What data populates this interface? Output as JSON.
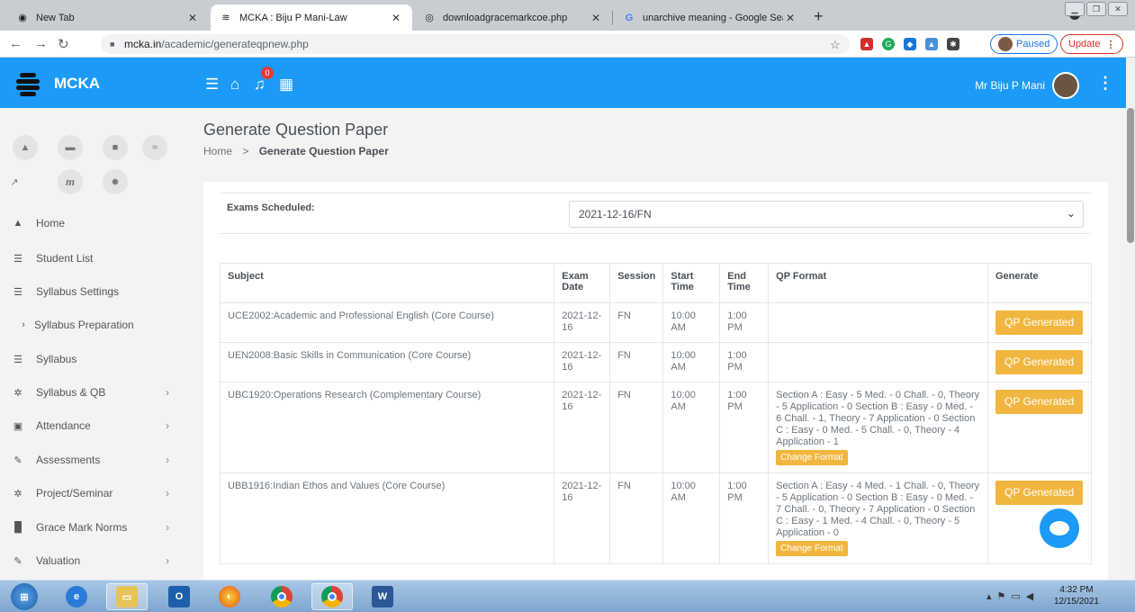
{
  "browser": {
    "tabs": [
      {
        "title": "New Tab"
      },
      {
        "title": "MCKA : Biju P Mani-Law"
      },
      {
        "title": "downloadgracemarkcoe.php"
      },
      {
        "title": "unarchive meaning - Google Sea"
      }
    ],
    "url_host": "mcka.in",
    "url_path": "/academic/generateqpnew.php",
    "paused_label": "Paused",
    "update_label": "Update"
  },
  "header": {
    "brand": "MCKA",
    "notif_count": "0",
    "user_name": "Mr Biju P Mani"
  },
  "sidebar": {
    "items": [
      {
        "label": "Home"
      },
      {
        "label": "Student List"
      },
      {
        "label": "Syllabus Settings"
      },
      {
        "label": "Syllabus Preparation"
      },
      {
        "label": "Syllabus"
      },
      {
        "label": "Syllabus & QB"
      },
      {
        "label": "Attendance"
      },
      {
        "label": "Assessments"
      },
      {
        "label": "Project/Seminar"
      },
      {
        "label": "Grace Mark Norms"
      },
      {
        "label": "Valuation"
      }
    ],
    "quick_m": "m"
  },
  "main": {
    "title": "Generate Question Paper",
    "crumb_home": "Home",
    "crumb_sep": ">",
    "crumb_current": "Generate Question Paper",
    "exam_label": "Exams Scheduled:",
    "exam_value": "2021-12-16/FN",
    "columns": [
      "Subject",
      "Exam Date",
      "Session",
      "Start Time",
      "End Time",
      "QP Format",
      "Generate"
    ],
    "rows": [
      {
        "subject": "UCE2002:Academic and Professional English (Core Course)",
        "date": "2021-12-16",
        "session": "FN",
        "start": "10:00 AM",
        "end": "1:00 PM",
        "format": "",
        "change": "",
        "generate": "QP Generated"
      },
      {
        "subject": "UEN2008:Basic Skills in Communication (Core Course)",
        "date": "2021-12-16",
        "session": "FN",
        "start": "10:00 AM",
        "end": "1:00 PM",
        "format": "",
        "change": "",
        "generate": "QP Generated"
      },
      {
        "subject": "UBC1920:Operations Research (Complementary Course)",
        "date": "2021-12-16",
        "session": "FN",
        "start": "10:00 AM",
        "end": "1:00 PM",
        "format": "Section A : Easy - 5 Med. - 0 Chall. - 0, Theory - 5 Application - 0 Section B : Easy - 0 Med. - 6 Chall. - 1, Theory - 7 Application - 0 Section C : Easy - 0 Med. - 5 Chall. - 0, Theory - 4 Application - 1",
        "change": "Change Format",
        "generate": "QP Generated"
      },
      {
        "subject": "UBB1916:Indian Ethos and Values (Core Course)",
        "date": "2021-12-16",
        "session": "FN",
        "start": "10:00 AM",
        "end": "1:00 PM",
        "format": "Section A : Easy - 4 Med. - 1 Chall. - 0, Theory - 5 Application - 0 Section B : Easy - 0 Med. - 7 Chall. - 0, Theory - 7 Application - 0 Section C : Easy - 1 Med. - 4 Chall. - 0, Theory - 5 Application - 0",
        "change": "Change Format",
        "generate": "QP Generated"
      }
    ]
  },
  "taskbar": {
    "time": "4:32 PM",
    "date": "12/15/2021"
  }
}
